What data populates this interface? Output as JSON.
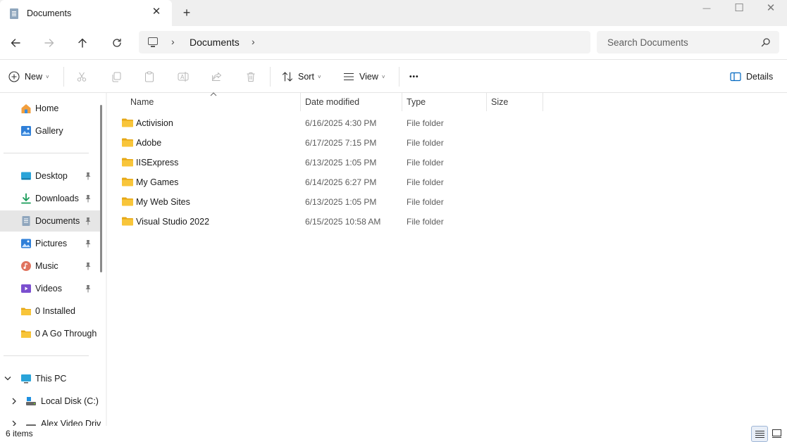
{
  "window": {
    "tab_title": "Documents",
    "tab_close_glyph": "✕",
    "new_tab_glyph": "+",
    "minimize_glyph": "—",
    "maximize_glyph": "☐",
    "close_glyph": "✕"
  },
  "nav": {
    "breadcrumb": [
      "This PC",
      "Documents"
    ],
    "current_folder": "Documents",
    "separator_glyph": "›",
    "search_placeholder": "Search Documents"
  },
  "toolbar": {
    "new_label": "New",
    "sort_label": "Sort",
    "view_label": "View",
    "more_glyph": "•••",
    "details_label": "Details",
    "dropdown_glyph": "˅"
  },
  "sidebar": {
    "items": [
      {
        "label": "Home",
        "icon": "home-icon"
      },
      {
        "label": "Gallery",
        "icon": "gallery-icon"
      },
      {
        "label": "Desktop",
        "icon": "desktop-icon",
        "pinned": true
      },
      {
        "label": "Downloads",
        "icon": "downloads-icon",
        "pinned": true
      },
      {
        "label": "Documents",
        "icon": "documents-icon",
        "pinned": true,
        "selected": true
      },
      {
        "label": "Pictures",
        "icon": "pictures-icon",
        "pinned": true
      },
      {
        "label": "Music",
        "icon": "music-icon",
        "pinned": true
      },
      {
        "label": "Videos",
        "icon": "videos-icon",
        "pinned": true
      },
      {
        "label": "0 Installed",
        "icon": "folder-icon"
      },
      {
        "label": "0 A Go Through",
        "icon": "folder-icon"
      }
    ],
    "this_pc": {
      "label": "This PC",
      "icon": "this-pc-icon",
      "expanded": true
    },
    "drives": [
      {
        "label": "Local Disk (C:)",
        "icon": "drive-icon"
      },
      {
        "label": "Alex Video Driv",
        "icon": "drive-icon"
      }
    ]
  },
  "columns": {
    "name": "Name",
    "date": "Date modified",
    "type": "Type",
    "size": "Size"
  },
  "files": [
    {
      "name": "Activision",
      "date": "6/16/2025 4:30 PM",
      "type": "File folder",
      "size": ""
    },
    {
      "name": "Adobe",
      "date": "6/17/2025 7:15 PM",
      "type": "File folder",
      "size": ""
    },
    {
      "name": "IISExpress",
      "date": "6/13/2025 1:05 PM",
      "type": "File folder",
      "size": ""
    },
    {
      "name": "My Games",
      "date": "6/14/2025 6:27 PM",
      "type": "File folder",
      "size": ""
    },
    {
      "name": "My Web Sites",
      "date": "6/13/2025 1:05 PM",
      "type": "File folder",
      "size": ""
    },
    {
      "name": "Visual Studio 2022",
      "date": "6/15/2025 10:58 AM",
      "type": "File folder",
      "size": ""
    }
  ],
  "status": {
    "item_count": "6 items"
  },
  "colors": {
    "accent": "#0067c0",
    "folder": "#f8c53a",
    "folder_dark": "#e6a817",
    "selected_bg": "#e6e6e6",
    "titlebar_bg": "#efefef"
  }
}
